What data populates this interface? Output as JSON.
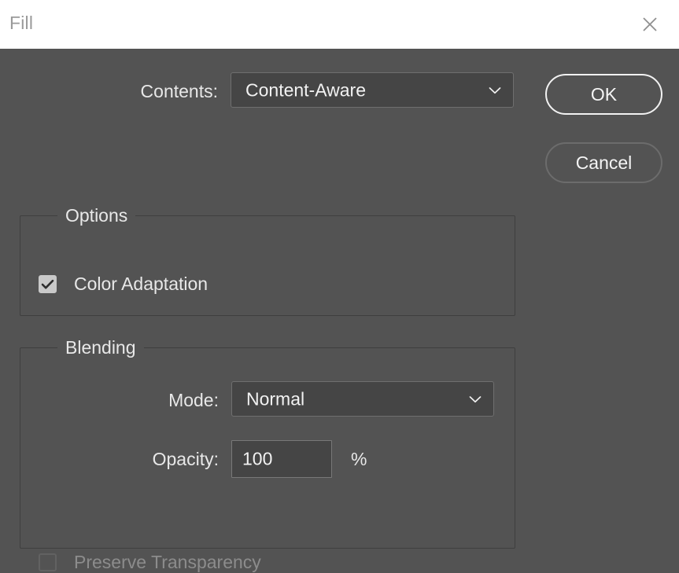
{
  "window": {
    "title": "Fill",
    "close_icon": "close-x-icon"
  },
  "contents": {
    "label": "Contents:",
    "selected": "Content-Aware",
    "chevron_icon": "chevron-down-icon"
  },
  "buttons": {
    "ok": "OK",
    "cancel": "Cancel"
  },
  "options_group": {
    "legend": "Options",
    "color_adaptation": {
      "label": "Color Adaptation",
      "checked": true,
      "check_icon": "checkmark-icon"
    }
  },
  "blending_group": {
    "legend": "Blending",
    "mode": {
      "label": "Mode:",
      "selected": "Normal",
      "chevron_icon": "chevron-down-icon"
    },
    "opacity": {
      "label": "Opacity:",
      "value": "100",
      "unit": "%"
    },
    "preserve_transparency": {
      "label": "Preserve Transparency",
      "checked": false,
      "disabled": true
    }
  },
  "colors": {
    "dialog_background": "#535353",
    "titlebar_background": "#ffffff",
    "titlebar_text": "#9a9a9a",
    "text_primary": "#e8e8e8",
    "text_disabled": "#8c8c8c",
    "field_background": "#454545",
    "field_border": "#6f6f6f",
    "fieldset_border": "#3f3f3f",
    "checkbox_fill": "#c9c9c9",
    "primary_button_border": "#f2f2f2",
    "secondary_button_border": "#6c6c6c"
  }
}
